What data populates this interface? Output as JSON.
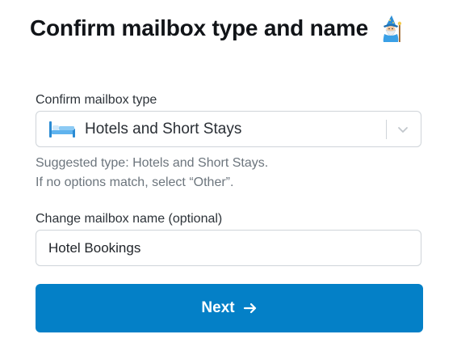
{
  "header": {
    "title": "Confirm mailbox type and name",
    "icon": "wizard-icon"
  },
  "mailbox_type": {
    "label": "Confirm mailbox type",
    "selected_value": "Hotels and Short Stays",
    "selected_icon": "bed-icon",
    "dropdown_icon": "chevron-down-icon",
    "hint_line1": "Suggested type: Hotels and Short Stays.",
    "hint_line2": "If no options match, select “Other”."
  },
  "mailbox_name": {
    "label": "Change mailbox name (optional)",
    "value": "Hotel Bookings"
  },
  "actions": {
    "next_label": "Next",
    "next_icon": "arrow-right-icon"
  },
  "colors": {
    "primary_button": "#0480c7",
    "border": "#cfd4d9",
    "hint_text": "#6c757d"
  }
}
